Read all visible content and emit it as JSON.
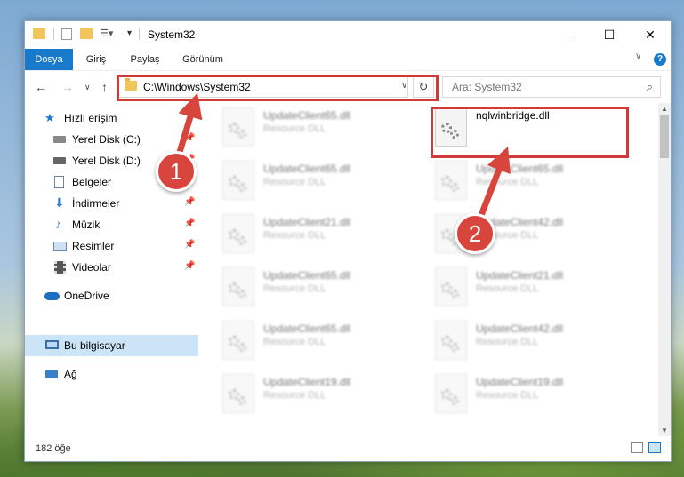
{
  "window": {
    "title": "System32"
  },
  "ribbon": {
    "tabs": [
      "Dosya",
      "Giriş",
      "Paylaş",
      "Görünüm"
    ],
    "help": "?"
  },
  "address": {
    "path": "C:\\Windows\\System32"
  },
  "search": {
    "placeholder": "Ara: System32"
  },
  "sidebar": {
    "items": [
      {
        "label": "Hızlı erişim",
        "icon": "star-icon"
      },
      {
        "label": "Yerel Disk (C:)",
        "icon": "drive-icon"
      },
      {
        "label": "Yerel Disk (D:)",
        "icon": "drive-icon"
      },
      {
        "label": "Belgeler",
        "icon": "documents-icon"
      },
      {
        "label": "İndirmeler",
        "icon": "download-icon"
      },
      {
        "label": "Müzik",
        "icon": "music-icon"
      },
      {
        "label": "Resimler",
        "icon": "pictures-icon"
      },
      {
        "label": "Videolar",
        "icon": "videos-icon"
      },
      {
        "label": "OneDrive",
        "icon": "cloud-icon"
      },
      {
        "label": "Bu bilgisayar",
        "icon": "computer-icon"
      },
      {
        "label": "Ağ",
        "icon": "network-icon"
      }
    ]
  },
  "files": {
    "featured": {
      "name": "nqlwinbridge.dll"
    },
    "left": [
      {
        "name": "UpdateClient65.dll",
        "type": "Resource DLL"
      },
      {
        "name": "UpdateClient65.dll",
        "type": "Resource DLL"
      },
      {
        "name": "UpdateClient21.dll",
        "type": "Resource DLL"
      },
      {
        "name": "UpdateClient65.dll",
        "type": "Resource DLL"
      },
      {
        "name": "UpdateClient65.dll",
        "type": "Resource DLL"
      },
      {
        "name": "UpdateClient19.dll",
        "type": "Resource DLL"
      }
    ],
    "right": [
      {
        "name": "UpdateClient65.dll",
        "type": "Resource DLL"
      },
      {
        "name": "UpdateClient42.dll",
        "type": "Resource DLL"
      },
      {
        "name": "UpdateClient21.dll",
        "type": "Resource DLL"
      },
      {
        "name": "UpdateClient42.dll",
        "type": "Resource DLL"
      },
      {
        "name": "UpdateClient19.dll",
        "type": "Resource DLL"
      }
    ]
  },
  "status": {
    "count": "182 öğe"
  },
  "annotations": {
    "step1": "1",
    "step2": "2",
    "color": "#d8453d"
  }
}
